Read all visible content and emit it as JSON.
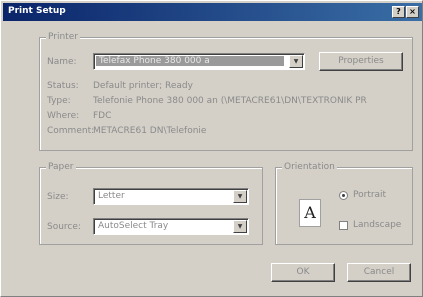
{
  "window": {
    "title": "Print Setup"
  },
  "titlebar_buttons": {
    "help": "?",
    "close": "×"
  },
  "printer": {
    "legend": "Printer",
    "name_label": "Name:",
    "name_value": "Telefax Phone 380 000 a",
    "properties_button": "Properties",
    "status_label": "Status:",
    "status_value": "Default printer; Ready",
    "type_label": "Type:",
    "type_value": "Telefonie Phone 380 000 an (\\METACRE61\\DN\\TEXTRONIK PR",
    "where_label": "Where:",
    "where_value": "FDC",
    "comment_label": "Comment:",
    "comment_value": "METACRE61 DN\\Telefonie"
  },
  "paper": {
    "legend": "Paper",
    "size_label": "Size:",
    "size_value": "Letter",
    "source_label": "Source:",
    "source_value": "AutoSelect Tray"
  },
  "orientation": {
    "legend": "Orientation",
    "icon_glyph": "A",
    "portrait_label": "Portrait",
    "landscape_label": "Landscape"
  },
  "footer": {
    "ok": "OK",
    "cancel": "Cancel"
  }
}
